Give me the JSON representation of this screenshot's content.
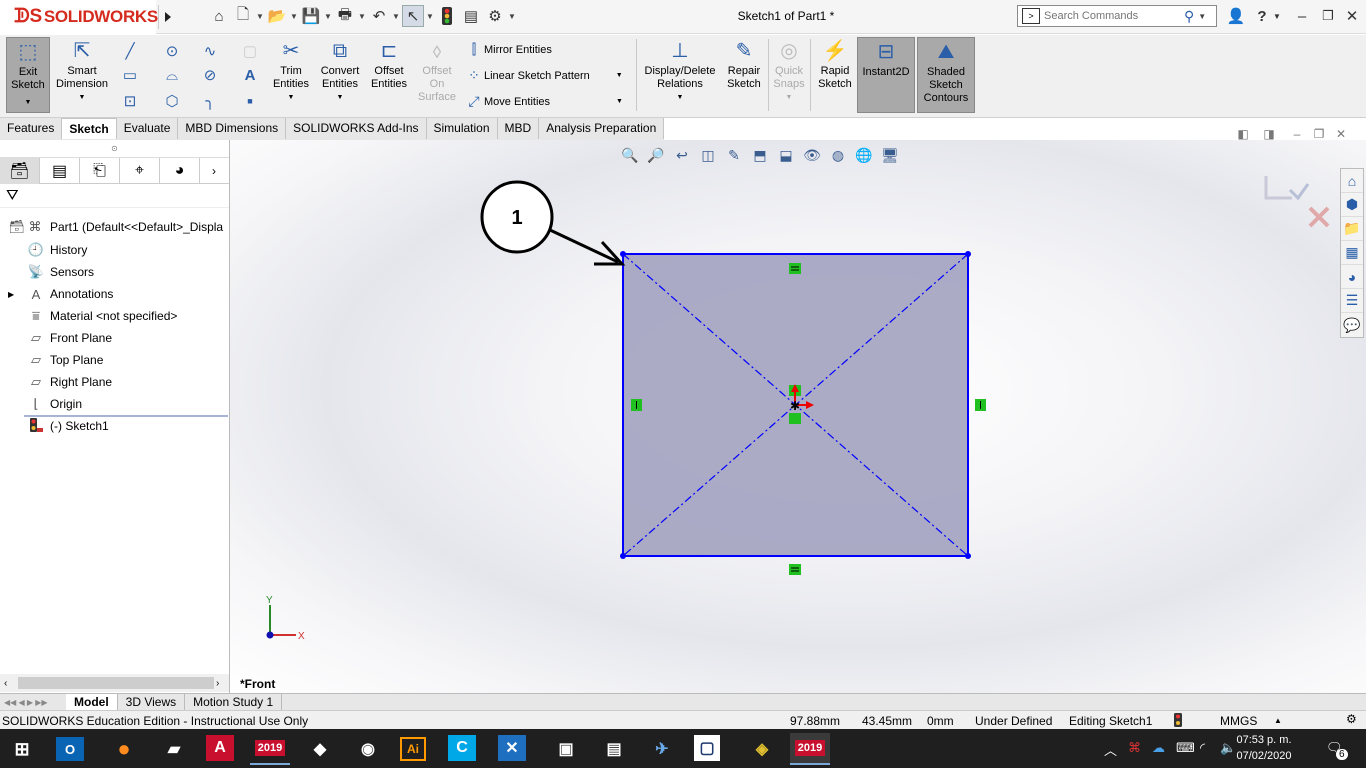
{
  "app": {
    "brand": "SOLIDWORKS",
    "document_title": "Sketch1 of Part1 *"
  },
  "search": {
    "placeholder": "Search Commands"
  },
  "ribbon": {
    "exit_sketch": "Exit Sketch",
    "smart_dimension": "Smart Dimension",
    "trim_entities": "Trim Entities",
    "convert_entities": "Convert Entities",
    "offset_entities": "Offset Entities",
    "offset_on_surface": "Offset On Surface",
    "mirror_entities": "Mirror Entities",
    "linear_sketch_pattern": "Linear Sketch Pattern",
    "move_entities": "Move Entities",
    "display_delete_relations": "Display/Delete Relations",
    "repair_sketch": "Repair Sketch",
    "quick_snaps": "Quick Snaps",
    "rapid_sketch": "Rapid Sketch",
    "instant2d": "Instant2D",
    "shaded_sketch_contours": "Shaded Sketch Contours"
  },
  "tabs": [
    "Features",
    "Sketch",
    "Evaluate",
    "MBD Dimensions",
    "SOLIDWORKS Add-Ins",
    "Simulation",
    "MBD",
    "Analysis Preparation"
  ],
  "tree": {
    "root": "Part1  (Default<<Default>_Displa",
    "history": "History",
    "sensors": "Sensors",
    "annotations": "Annotations",
    "material": "Material <not specified>",
    "front_plane": "Front Plane",
    "top_plane": "Top Plane",
    "right_plane": "Right Plane",
    "origin": "Origin",
    "sketch": "(-) Sketch1"
  },
  "viewport": {
    "callout_number": "1",
    "view_name": "*Front",
    "triad_x": "X",
    "triad_y": "Y",
    "sketch_line_color": "#0000ff",
    "relation_color": "#1fc01f",
    "fill_color": "#a2a2c0"
  },
  "bottom_tabs": [
    "Model",
    "3D Views",
    "Motion Study 1"
  ],
  "status": {
    "edition": "SOLIDWORKS Education Edition - Instructional Use Only",
    "x": "97.88mm",
    "y": "43.45mm",
    "z": "0mm",
    "definition": "Under Defined",
    "editing": "Editing Sketch1",
    "units": "MMGS"
  },
  "taskbar": {
    "time": "07:53 p. m.",
    "date": "07/02/2020",
    "sw_year": "2019",
    "notifications": "6"
  }
}
